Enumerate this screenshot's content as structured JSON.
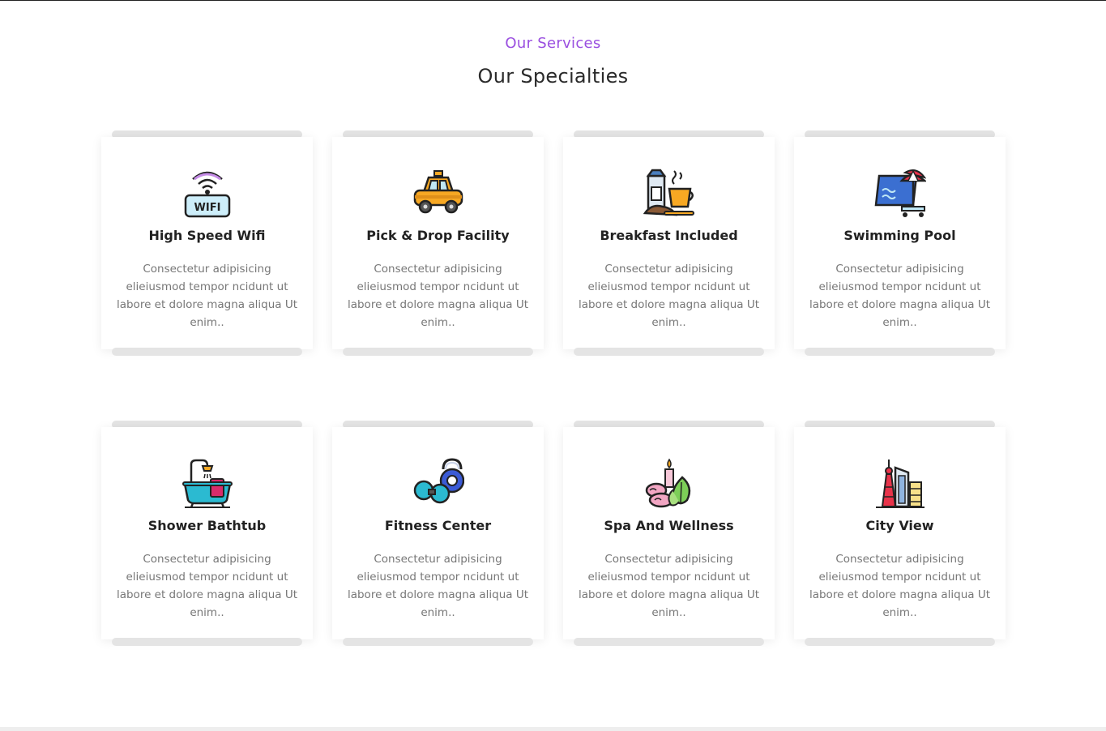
{
  "section": {
    "eyebrow": "Our Services",
    "title": "Our Specialties"
  },
  "colors": {
    "accent": "#9a4fe0",
    "title": "#2a2a2a",
    "body_text": "#777777"
  },
  "cards": [
    {
      "title": "High Speed Wifi",
      "icon": "wifi-icon",
      "icon_label": "WIFI",
      "text": "Consectetur adipisicing elieiusmod tempor ncidunt ut labore et dolore magna aliqua Ut enim.."
    },
    {
      "title": "Pick & Drop Facility",
      "icon": "taxi-icon",
      "text": "Consectetur adipisicing elieiusmod tempor ncidunt ut labore et dolore magna aliqua Ut enim.."
    },
    {
      "title": "Breakfast Included",
      "icon": "breakfast-icon",
      "text": "Consectetur adipisicing elieiusmod tempor ncidunt ut labore et dolore magna aliqua Ut enim.."
    },
    {
      "title": "Swimming Pool",
      "icon": "pool-icon",
      "text": "Consectetur adipisicing elieiusmod tempor ncidunt ut labore et dolore magna aliqua Ut enim.."
    },
    {
      "title": "Shower Bathtub",
      "icon": "bathtub-icon",
      "text": "Consectetur adipisicing elieiusmod tempor ncidunt ut labore et dolore magna aliqua Ut enim.."
    },
    {
      "title": "Fitness Center",
      "icon": "fitness-icon",
      "text": "Consectetur adipisicing elieiusmod tempor ncidunt ut labore et dolore magna aliqua Ut enim.."
    },
    {
      "title": "Spa And Wellness",
      "icon": "spa-icon",
      "text": "Consectetur adipisicing elieiusmod tempor ncidunt ut labore et dolore magna aliqua Ut enim.."
    },
    {
      "title": "City View",
      "icon": "city-icon",
      "text": "Consectetur adipisicing elieiusmod tempor ncidunt ut labore et dolore magna aliqua Ut enim.."
    }
  ]
}
